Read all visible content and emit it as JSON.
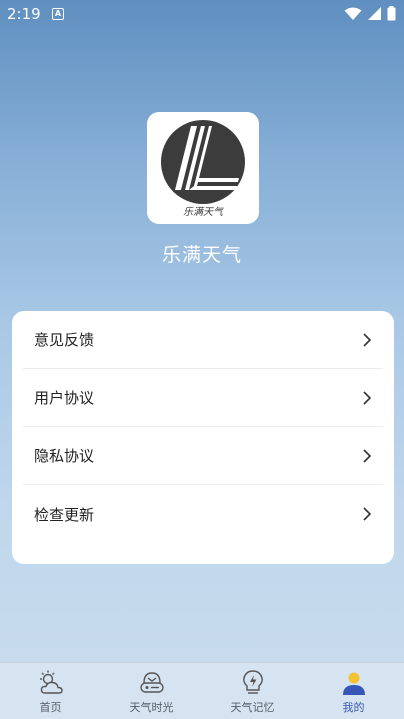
{
  "status_bar": {
    "time": "2:19",
    "notification_icon": "A"
  },
  "app": {
    "logo_text": "乐满天气",
    "name": "乐满天气"
  },
  "menu": [
    {
      "label": "意见反馈"
    },
    {
      "label": "用户协议"
    },
    {
      "label": "隐私协议"
    },
    {
      "label": "检查更新"
    }
  ],
  "tabs": [
    {
      "label": "首页",
      "icon": "partly-cloudy-icon",
      "active": false
    },
    {
      "label": "天气时光",
      "icon": "weather-time-icon",
      "active": false
    },
    {
      "label": "天气记忆",
      "icon": "lightning-bulb-icon",
      "active": false
    },
    {
      "label": "我的",
      "icon": "user-profile-icon",
      "active": true
    }
  ],
  "colors": {
    "accent": "#3a5ab0",
    "avatar_head": "#f2c230",
    "avatar_body": "#3657b8"
  }
}
